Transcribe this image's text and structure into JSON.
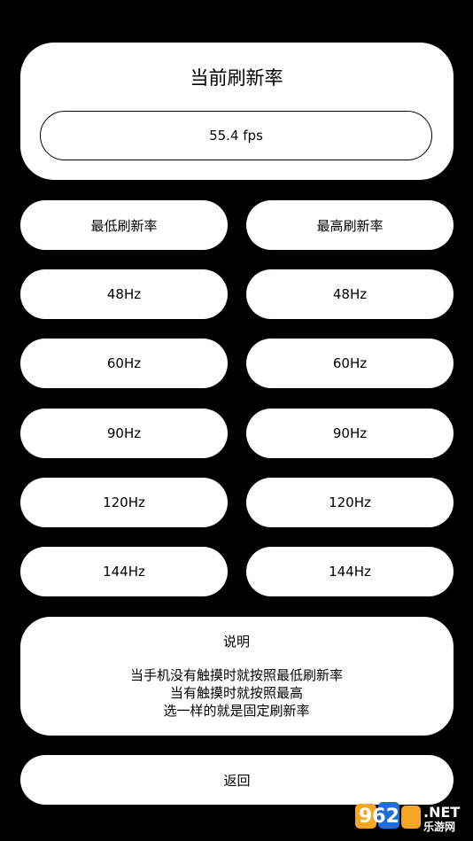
{
  "current_rate": {
    "title": "当前刷新率",
    "value": "55.4 fps"
  },
  "min_column": {
    "header": "最低刷新率",
    "options": [
      "48Hz",
      "60Hz",
      "90Hz",
      "120Hz",
      "144Hz"
    ]
  },
  "max_column": {
    "header": "最高刷新率",
    "options": [
      "48Hz",
      "60Hz",
      "90Hz",
      "120Hz",
      "144Hz"
    ]
  },
  "info": {
    "title": "说明",
    "lines": [
      "当手机没有触摸时就按照最低刷新率",
      "当有触摸时就按照最高",
      "选一样的就是固定刷新率"
    ]
  },
  "back_label": "返回",
  "watermark": {
    "brand": "962",
    "suffix": ".NET",
    "sub": "乐游网"
  },
  "colors": {
    "background": "#000000",
    "card": "#ffffff",
    "text": "#000000",
    "watermark_orange": "#f5a623",
    "watermark_blue": "#1e6fd9"
  }
}
